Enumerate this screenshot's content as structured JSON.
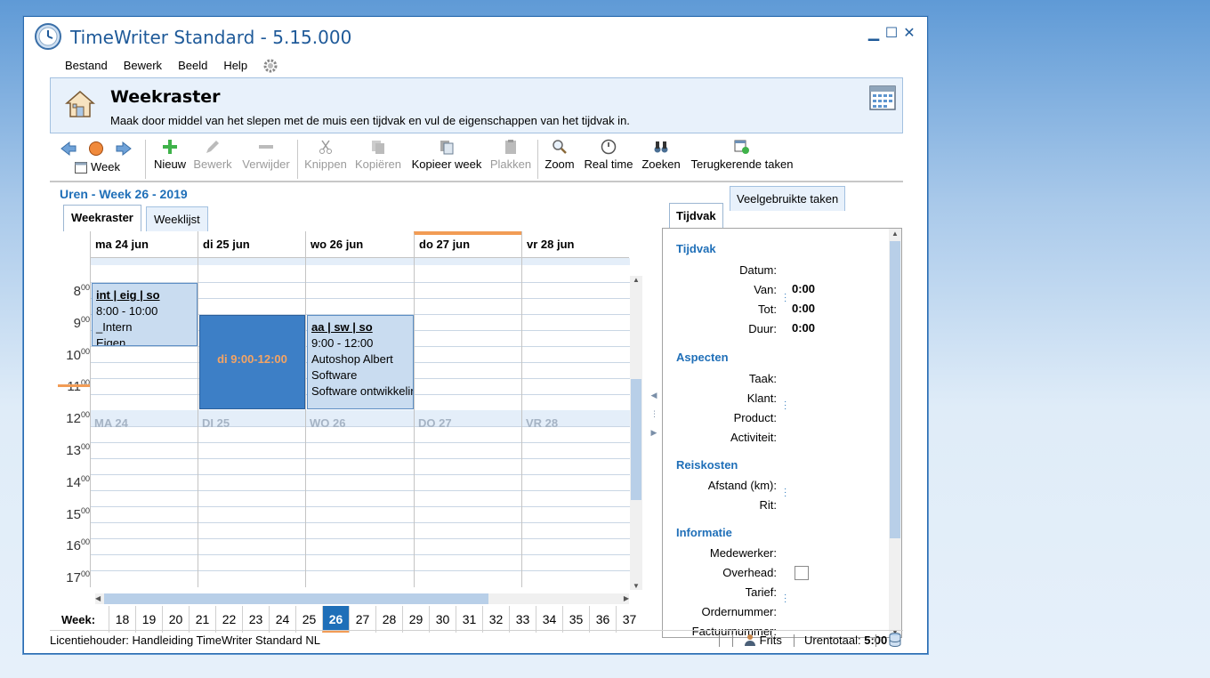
{
  "window": {
    "title": "TimeWriter Standard - 5.15.000"
  },
  "menu": [
    "Bestand",
    "Bewerk",
    "Beeld",
    "Help"
  ],
  "banner": {
    "title": "Weekraster",
    "description": "Maak door middel van het slepen met de muis een tijdvak en vul de eigenschappen van het tijdvak in."
  },
  "toolbar": {
    "week_label": "Week",
    "buttons": [
      {
        "label": "Nieuw",
        "icon": "plus-icon",
        "enabled": true
      },
      {
        "label": "Bewerk",
        "icon": "pencil-icon",
        "enabled": false
      },
      {
        "label": "Verwijder",
        "icon": "minus-icon",
        "enabled": false
      },
      {
        "label": "Knippen",
        "icon": "scissors-icon",
        "enabled": false
      },
      {
        "label": "Kopiëren",
        "icon": "copy-icon",
        "enabled": false
      },
      {
        "label": "Kopieer week",
        "icon": "copy-week-icon",
        "enabled": true
      },
      {
        "label": "Plakken",
        "icon": "paste-icon",
        "enabled": false
      },
      {
        "label": "Zoom",
        "icon": "zoom-icon",
        "enabled": true
      },
      {
        "label": "Real time",
        "icon": "clock-icon",
        "enabled": true
      },
      {
        "label": "Zoeken",
        "icon": "binoculars-icon",
        "enabled": true
      },
      {
        "label": "Terugkerende taken",
        "icon": "recurring-tasks-icon",
        "enabled": true
      }
    ]
  },
  "calendar": {
    "header": "Uren - Week 26 - 2019",
    "tabs": [
      "Weekraster",
      "Weeklijst"
    ],
    "active_tab": "Weekraster",
    "days": [
      "ma 24 jun",
      "di 25 jun",
      "wo 26 jun",
      "do 27 jun",
      "vr 28 jun"
    ],
    "days_short": [
      "MA 24",
      "DI 25",
      "WO 26",
      "DO 27",
      "VR 28"
    ],
    "today_index": 3,
    "hours": [
      "8",
      "9",
      "10",
      "11",
      "12",
      "13",
      "14",
      "15",
      "16",
      "17"
    ],
    "minutes_suffix": "00",
    "appointments": [
      {
        "title": "int | eig | so",
        "time": "8:00 - 10:00",
        "lines": [
          "_Intern",
          "Eigen"
        ]
      },
      {
        "selection_text": "di 9:00-12:00"
      },
      {
        "title": "aa | sw | so",
        "time": "9:00 - 12:00",
        "lines": [
          "Autoshop Albert",
          "Software",
          "Software ontwikkeling"
        ]
      }
    ],
    "week_label": "Week:",
    "weeks": [
      "18",
      "19",
      "20",
      "21",
      "22",
      "23",
      "24",
      "25",
      "26",
      "27",
      "28",
      "29",
      "30",
      "31",
      "32",
      "33",
      "34",
      "35",
      "36",
      "37"
    ],
    "current_week": "26"
  },
  "right_panel": {
    "tabs": [
      "Tijdvak",
      "Veelgebruikte taken"
    ],
    "active_tab": "Tijdvak",
    "sections": {
      "tijdvak": {
        "title": "Tijdvak",
        "datum": "Datum:",
        "van": "Van:",
        "tot": "Tot:",
        "duur": "Duur:",
        "van_val": "0:00",
        "tot_val": "0:00",
        "duur_val": "0:00"
      },
      "aspecten": {
        "title": "Aspecten",
        "taak": "Taak:",
        "klant": "Klant:",
        "product": "Product:",
        "activiteit": "Activiteit:"
      },
      "reiskosten": {
        "title": "Reiskosten",
        "afstand": "Afstand (km):",
        "rit": "Rit:"
      },
      "informatie": {
        "title": "Informatie",
        "medewerker": "Medewerker:",
        "overhead": "Overhead:",
        "tarief": "Tarief:",
        "ordernummer": "Ordernummer:",
        "factuurnummer": "Factuurnummer:"
      }
    }
  },
  "status": {
    "license": "Licentiehouder: Handleiding TimeWriter Standard NL",
    "user": "Frits",
    "total_label": "Urentotaal:",
    "total_value": "5:00"
  },
  "colors": {
    "accent": "#1f6fb8",
    "today": "#f29c55",
    "selection": "#3d7fc6",
    "appointment": "#c9dcf0"
  }
}
